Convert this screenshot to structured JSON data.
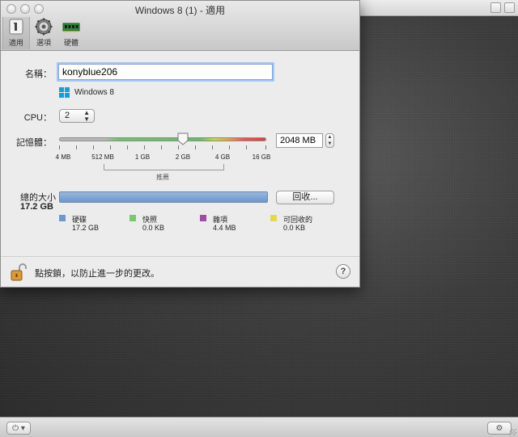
{
  "window": {
    "title": "Windows 8 (1) - 適用"
  },
  "toolbar": {
    "tabs": [
      {
        "label": "適用",
        "icon": "general-icon",
        "active": true
      },
      {
        "label": "選項",
        "icon": "options-gear-icon",
        "active": false
      },
      {
        "label": "硬體",
        "icon": "hardware-chip-icon",
        "active": false
      }
    ]
  },
  "general": {
    "name_label": "名稱：",
    "name_value": "konyblue206",
    "os_name": "Windows 8",
    "cpu_label": "CPU：",
    "cpu_value": "2",
    "memory_label": "記憶體：",
    "memory_ticks": [
      "4 MB",
      "512 MB",
      "1 GB",
      "2 GB",
      "4 GB",
      "16 GB"
    ],
    "memory_value": "2048 MB",
    "recommended_label": "推薦",
    "total_size_label": "總的大小",
    "total_size_value": "17.2 GB",
    "reclaim_button": "回收...",
    "legend": [
      {
        "name": "硬碟",
        "size": "17.2 GB",
        "color": "#6f97c9"
      },
      {
        "name": "快照",
        "size": "0.0 KB",
        "color": "#77c96a"
      },
      {
        "name": "雜項",
        "size": "4.4 MB",
        "color": "#9b4ea3"
      },
      {
        "name": "可回收的",
        "size": "0.0 KB",
        "color": "#e7d84a"
      }
    ]
  },
  "footer": {
    "lock_text": "點按鎖，以防止進一步的更改。",
    "help_label": "?"
  }
}
